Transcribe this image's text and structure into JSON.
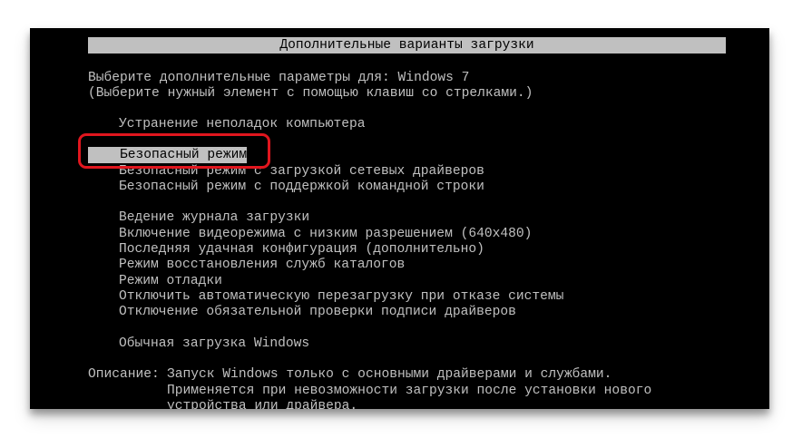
{
  "title": "Дополнительные варианты загрузки",
  "intro": [
    "Выберите дополнительные параметры для: Windows 7",
    "(Выберите нужный элемент с помощью клавиш со стрелками.)"
  ],
  "options": [
    "Устранение неполадок компьютера",
    "Безопасный режим",
    "Безопасный режим с загрузкой сетевых драйверов",
    "Безопасный режим с поддержкой командной строки",
    "Ведение журнала загрузки",
    "Включение видеорежима с низким разрешением (640x480)",
    "Последняя удачная конфигурация (дополнительно)",
    "Режим восстановления служб каталогов",
    "Режим отладки",
    "Отключить автоматическую перезагрузку при отказе системы",
    "Отключение обязательной проверки подписи драйверов",
    "Обычная загрузка Windows"
  ],
  "selected_option": "Безопасный режим",
  "description": {
    "label": "Описание:",
    "lines": [
      "Запуск Windows только с основными драйверами и службами.",
      "Применяется при невозможности загрузки после установки нового",
      "устройства или драйвера."
    ]
  },
  "colors": {
    "highlight": "#e0161e",
    "text": "#c0c0c0",
    "background": "#000000"
  }
}
